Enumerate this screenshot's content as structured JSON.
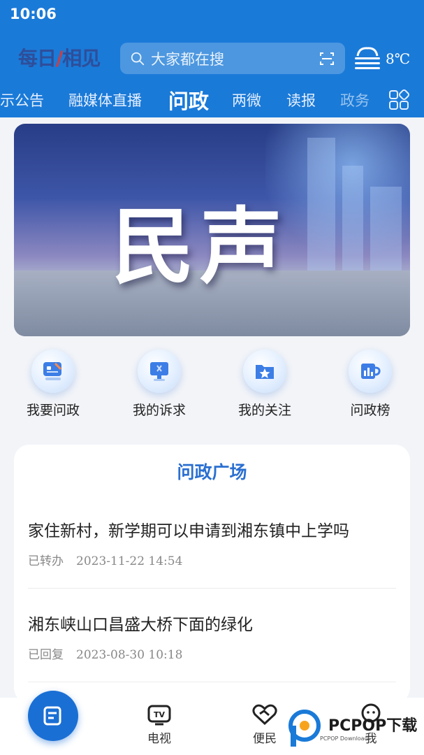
{
  "status_bar": {
    "time": "10:06"
  },
  "header": {
    "logo": {
      "part1": "每日",
      "accent": "/",
      "part2": "相见"
    },
    "search": {
      "placeholder": "大家都在搜"
    },
    "weather": {
      "temperature": "8℃",
      "icon": "fog-icon"
    }
  },
  "tabs": [
    {
      "label": "示公告"
    },
    {
      "label": "融媒体直播"
    },
    {
      "label": "问政",
      "active": true
    },
    {
      "label": "两微"
    },
    {
      "label": "读报"
    },
    {
      "label": "政务"
    }
  ],
  "banner": {
    "title": "民声"
  },
  "quick_entries": [
    {
      "label": "我要问政",
      "icon": "chat-icon"
    },
    {
      "label": "我的诉求",
      "icon": "monitor-icon"
    },
    {
      "label": "我的关注",
      "icon": "star-folder-icon"
    },
    {
      "label": "问政榜",
      "icon": "trophy-icon"
    }
  ],
  "plaza": {
    "title": "问政广场",
    "posts": [
      {
        "title": "家住新村，新学期可以申请到湘东镇中上学吗",
        "status": "已转办",
        "date": "2023-11-22 14:54"
      },
      {
        "title": "湘东峡山口昌盛大桥下面的绿化",
        "status": "已回复",
        "date": "2023-08-30 10:18"
      }
    ]
  },
  "bottom_nav": [
    {
      "label": "",
      "icon": "document-icon",
      "active": true
    },
    {
      "label": "电视",
      "icon": "tv-icon"
    },
    {
      "label": "便民",
      "icon": "heart-handshake-icon"
    },
    {
      "label": "我",
      "icon": "user-icon"
    }
  ],
  "watermark": {
    "text": "PCPOP下载",
    "sub": "PCPOP Download"
  },
  "colors": {
    "primary": "#1a7ad8",
    "accent": "#2a6fd1",
    "text": "#222222",
    "meta": "#888888"
  }
}
